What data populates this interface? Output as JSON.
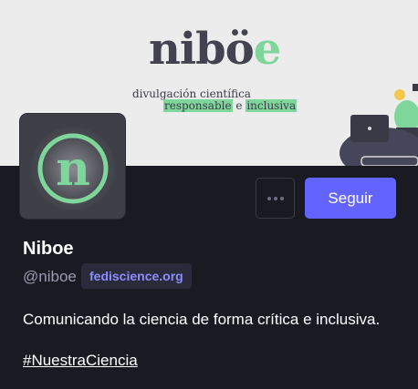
{
  "header": {
    "logo": {
      "part1": "nibö",
      "part2": "e"
    },
    "tagline": {
      "line1": "divulgación científica",
      "word_responsible": "responsable",
      "connector": " e ",
      "word_inclusive": "inclusiva"
    }
  },
  "actions": {
    "more_icon": "ellipsis-icon",
    "follow_label": "Seguir"
  },
  "profile": {
    "display_name": "Niboe",
    "handle": "@niboe",
    "server": "fediscience.org",
    "bio": "Comunicando la ciencia de forma crítica e inclusiva.",
    "hashtag": "#NuestraCiencia"
  },
  "colors": {
    "accent": "#6364ff",
    "brand_green": "#7fd69a",
    "background": "#191a22"
  }
}
